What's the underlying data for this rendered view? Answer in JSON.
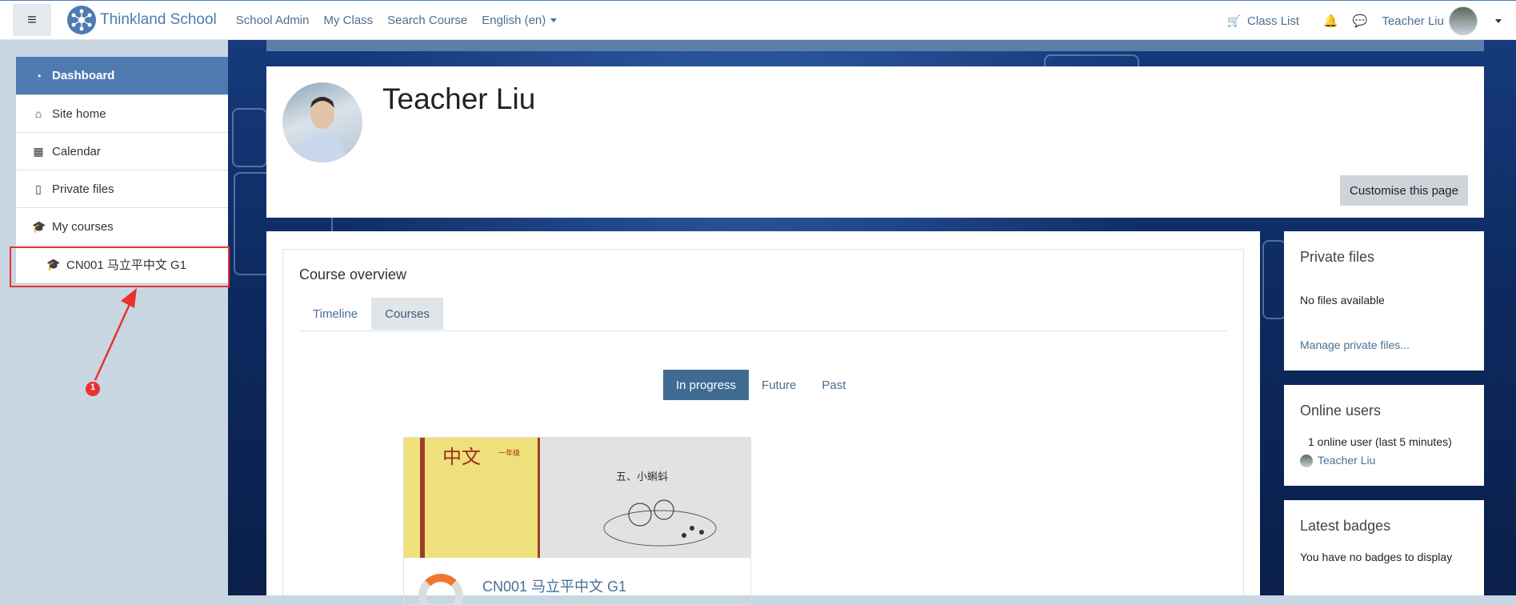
{
  "navbar": {
    "brand": "Thinkland School",
    "links": [
      "School Admin",
      "My Class",
      "Search Course",
      "English (en)"
    ],
    "class_list": "Class List",
    "user_name": "Teacher Liu"
  },
  "drawer": {
    "items": [
      {
        "label": "Dashboard",
        "icon": "dashboard-icon"
      },
      {
        "label": "Site home",
        "icon": "home-icon"
      },
      {
        "label": "Calendar",
        "icon": "calendar-icon"
      },
      {
        "label": "Private files",
        "icon": "file-icon"
      },
      {
        "label": "My courses",
        "icon": "graduation-cap-icon"
      },
      {
        "label": "CN001 马立平中文 G1",
        "icon": "graduation-cap-icon"
      }
    ],
    "annotation_marker": "1"
  },
  "header": {
    "name": "Teacher Liu",
    "customise_button": "Customise this page"
  },
  "course_overview": {
    "title": "Course overview",
    "tabs": [
      "Timeline",
      "Courses"
    ],
    "active_tab": "Courses",
    "filters": [
      "In progress",
      "Future",
      "Past"
    ],
    "active_filter": "In progress",
    "course": {
      "name": "CN001 马立平中文 G1",
      "image_title": "中文",
      "image_subtitle": "一年级",
      "image_page_text": "五、小蝌蚪"
    }
  },
  "blocks": {
    "private_files": {
      "title": "Private files",
      "empty": "No files available",
      "link": "Manage private files..."
    },
    "online_users": {
      "title": "Online users",
      "summary": "1 online user (last 5 minutes)",
      "user": "Teacher Liu"
    },
    "latest_badges": {
      "title": "Latest badges",
      "empty": "You have no badges to display"
    }
  },
  "colors": {
    "accent": "#4f7bb1",
    "annotation": "#e8322f",
    "active_filter": "#3f6b92"
  }
}
